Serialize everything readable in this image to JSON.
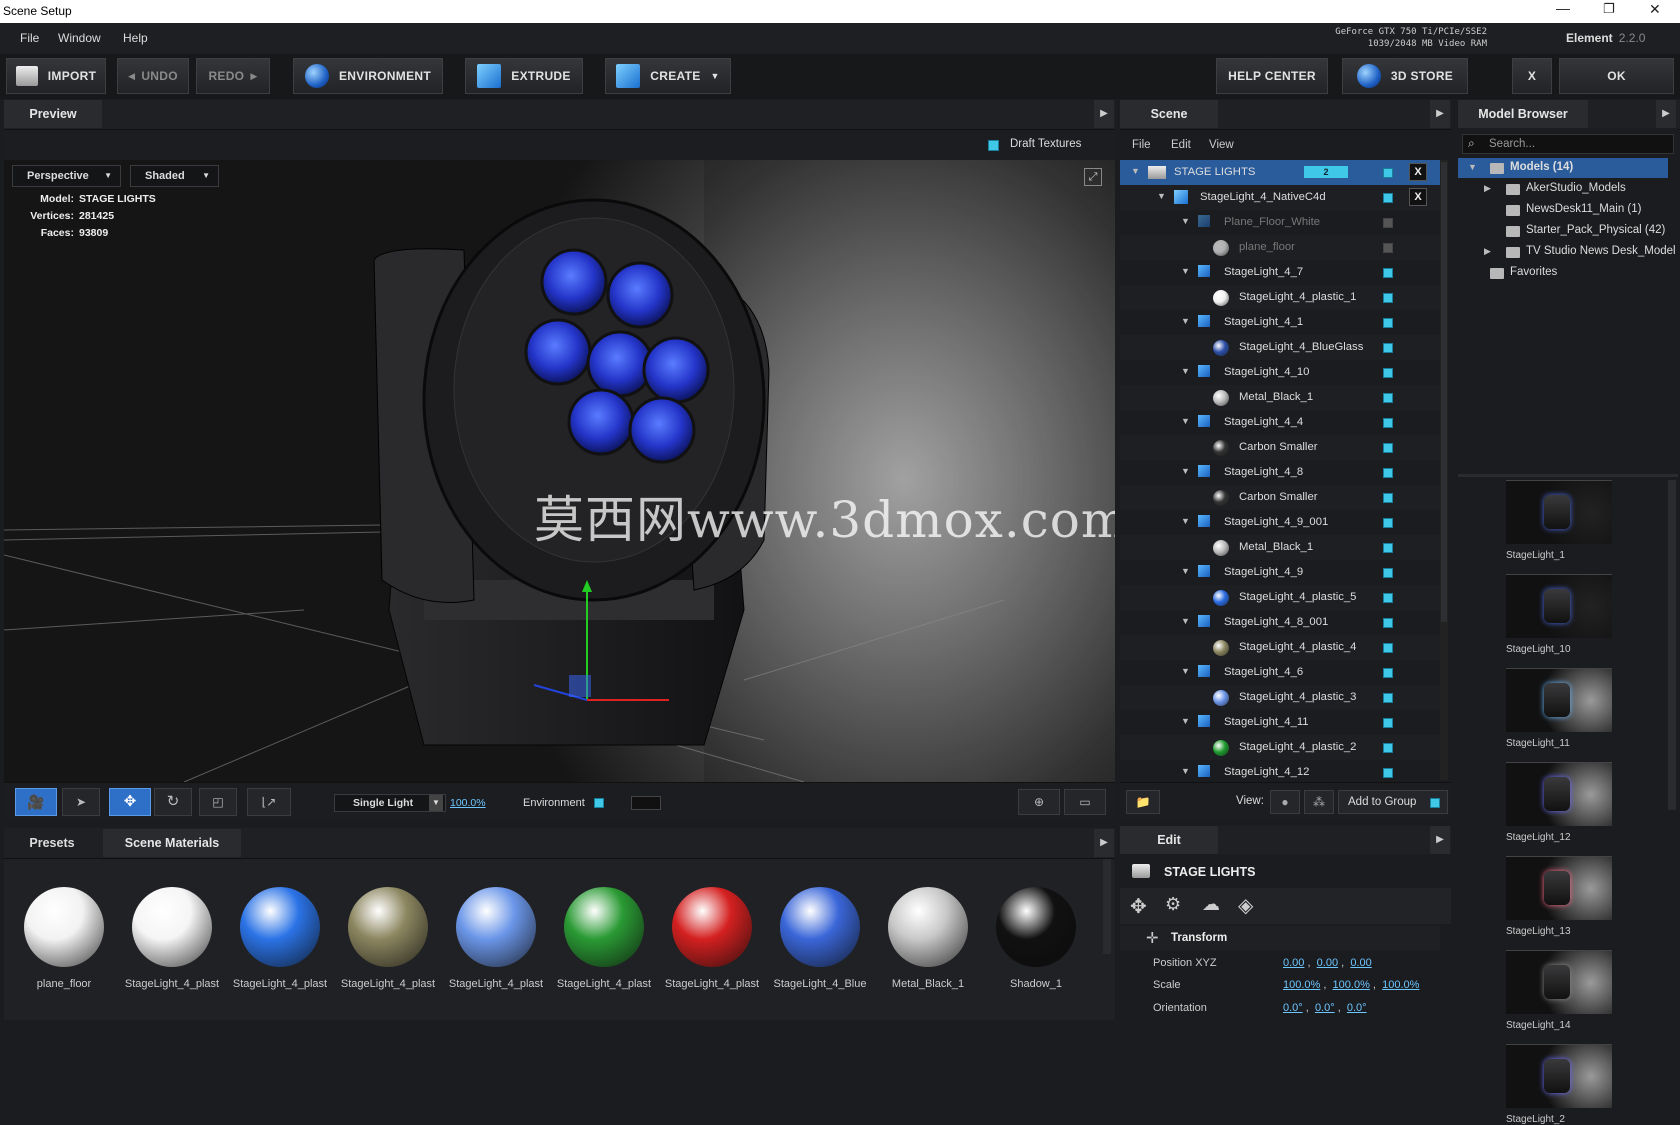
{
  "window": {
    "title": "Scene Setup",
    "minimize": "—",
    "restore": "❐",
    "close": "✕"
  },
  "menu": {
    "file": "File",
    "window": "Window",
    "help": "Help"
  },
  "gpu": {
    "line1": "GeForce GTX 750 Ti/PCIe/SSE2",
    "line2": "1039/2048 MB Video RAM"
  },
  "product": {
    "name": "Element",
    "version": "2.2.0"
  },
  "toolbar": {
    "import": "IMPORT",
    "undo": "UNDO",
    "redo": "REDO",
    "environment": "ENVIRONMENT",
    "extrude": "EXTRUDE",
    "create": "CREATE",
    "help_center": "HELP CENTER",
    "store": "3D STORE",
    "close": "X",
    "ok": "OK"
  },
  "preview": {
    "tab": "Preview",
    "draft": "Draft Textures",
    "view_mode": "Perspective",
    "shading": "Shaded",
    "model_label": "Model:",
    "model": "STAGE LIGHTS",
    "vertices_label": "Vertices:",
    "vertices": "281425",
    "faces_label": "Faces:",
    "faces": "93809",
    "lighting": "Single Light",
    "intensity": "100.0%",
    "environment": "Environment"
  },
  "watermark": "莫西网www.3dmox.com",
  "scene": {
    "tab": "Scene",
    "menu": [
      "File",
      "Edit",
      "View"
    ],
    "view_label": "View:",
    "add_group": "Add to Group",
    "group_count": "2",
    "rows": [
      {
        "label": "STAGE LIGHTS",
        "kind": "folder",
        "depth": 0,
        "tri": "▼",
        "x": true,
        "selected": true
      },
      {
        "label": "StageLight_4_NativeC4d",
        "kind": "obj",
        "depth": 1,
        "tri": "▼",
        "x": true
      },
      {
        "label": "Plane_Floor_White",
        "kind": "group",
        "depth": 2,
        "tri": "▼",
        "dim": true
      },
      {
        "label": "plane_floor",
        "kind": "mat",
        "depth": 3,
        "color": "#eee",
        "dim": true
      },
      {
        "label": "StageLight_4_7",
        "kind": "group",
        "depth": 2,
        "tri": "▼"
      },
      {
        "label": "StageLight_4_plastic_1",
        "kind": "mat",
        "depth": 3,
        "color": "#f0f0f0"
      },
      {
        "label": "StageLight_4_1",
        "kind": "group",
        "depth": 2,
        "tri": "▼"
      },
      {
        "label": "StageLight_4_BlueGlass",
        "kind": "mat",
        "depth": 3,
        "color": "#2c4fa8"
      },
      {
        "label": "StageLight_4_10",
        "kind": "group",
        "depth": 2,
        "tri": "▼"
      },
      {
        "label": "Metal_Black_1",
        "kind": "mat",
        "depth": 3,
        "color": "#bbb"
      },
      {
        "label": "StageLight_4_4",
        "kind": "group",
        "depth": 2,
        "tri": "▼"
      },
      {
        "label": "Carbon Smaller",
        "kind": "mat",
        "depth": 3,
        "color": "#333"
      },
      {
        "label": "StageLight_4_8",
        "kind": "group",
        "depth": 2,
        "tri": "▼"
      },
      {
        "label": "Carbon Smaller",
        "kind": "mat",
        "depth": 3,
        "color": "#333"
      },
      {
        "label": "StageLight_4_9_001",
        "kind": "group",
        "depth": 2,
        "tri": "▼"
      },
      {
        "label": "Metal_Black_1",
        "kind": "mat",
        "depth": 3,
        "color": "#bbb"
      },
      {
        "label": "StageLight_4_9",
        "kind": "group",
        "depth": 2,
        "tri": "▼"
      },
      {
        "label": "StageLight_4_plastic_5",
        "kind": "mat",
        "depth": 3,
        "color": "#2a6be0"
      },
      {
        "label": "StageLight_4_8_001",
        "kind": "group",
        "depth": 2,
        "tri": "▼"
      },
      {
        "label": "StageLight_4_plastic_4",
        "kind": "mat",
        "depth": 3,
        "color": "#8a8560"
      },
      {
        "label": "StageLight_4_6",
        "kind": "group",
        "depth": 2,
        "tri": "▼"
      },
      {
        "label": "StageLight_4_plastic_3",
        "kind": "mat",
        "depth": 3,
        "color": "#6b94e8"
      },
      {
        "label": "StageLight_4_11",
        "kind": "group",
        "depth": 2,
        "tri": "▼"
      },
      {
        "label": "StageLight_4_plastic_2",
        "kind": "mat",
        "depth": 3,
        "color": "#1e9a2e"
      },
      {
        "label": "StageLight_4_12",
        "kind": "group",
        "depth": 2,
        "tri": "▼"
      }
    ]
  },
  "model_browser": {
    "tab": "Model Browser",
    "search_placeholder": "Search...",
    "tree": [
      {
        "label": "Models (14)",
        "depth": 0,
        "tri": "▼",
        "selected": true
      },
      {
        "label": "AkerStudio_Models",
        "depth": 1,
        "tri": "▶"
      },
      {
        "label": "NewsDesk11_Main (1)",
        "depth": 1,
        "tri": ""
      },
      {
        "label": "Starter_Pack_Physical (42)",
        "depth": 1,
        "tri": ""
      },
      {
        "label": "TV Studio News Desk_Model",
        "depth": 1,
        "tri": "▶"
      },
      {
        "label": "Favorites",
        "depth": 0,
        "tri": ""
      }
    ],
    "thumbs": [
      "StageLight_1",
      "StageLight_10",
      "StageLight_11",
      "StageLight_12",
      "StageLight_13",
      "StageLight_14",
      "StageLight_2"
    ]
  },
  "materials": {
    "tab_presets": "Presets",
    "tab_scene": "Scene Materials",
    "items": [
      {
        "label": "plane_floor",
        "color": "#f2f2f2"
      },
      {
        "label": "StageLight_4_plast",
        "color": "#f5f5f5"
      },
      {
        "label": "StageLight_4_plast",
        "color": "#2b73e6"
      },
      {
        "label": "StageLight_4_plast",
        "color": "#8c8660"
      },
      {
        "label": "StageLight_4_plast",
        "color": "#6b96e8"
      },
      {
        "label": "StageLight_4_plast",
        "color": "#2a9a34"
      },
      {
        "label": "StageLight_4_plast",
        "color": "#d42020"
      },
      {
        "label": "StageLight_4_Blue",
        "color": "#3a66d8"
      },
      {
        "label": "Metal_Black_1",
        "color": "#c8c8c8"
      },
      {
        "label": "Shadow_1",
        "color": "#111111"
      }
    ]
  },
  "edit": {
    "tab": "Edit",
    "object": "STAGE LIGHTS",
    "transform": "Transform",
    "position_label": "Position XYZ",
    "position": [
      "0.00",
      "0.00",
      "0.00"
    ],
    "scale_label": "Scale",
    "scale": [
      "100.0%",
      "100.0%",
      "100.0%"
    ],
    "orientation_label": "Orientation",
    "orientation": [
      "0.0°",
      "0.0°",
      "0.0°"
    ]
  }
}
